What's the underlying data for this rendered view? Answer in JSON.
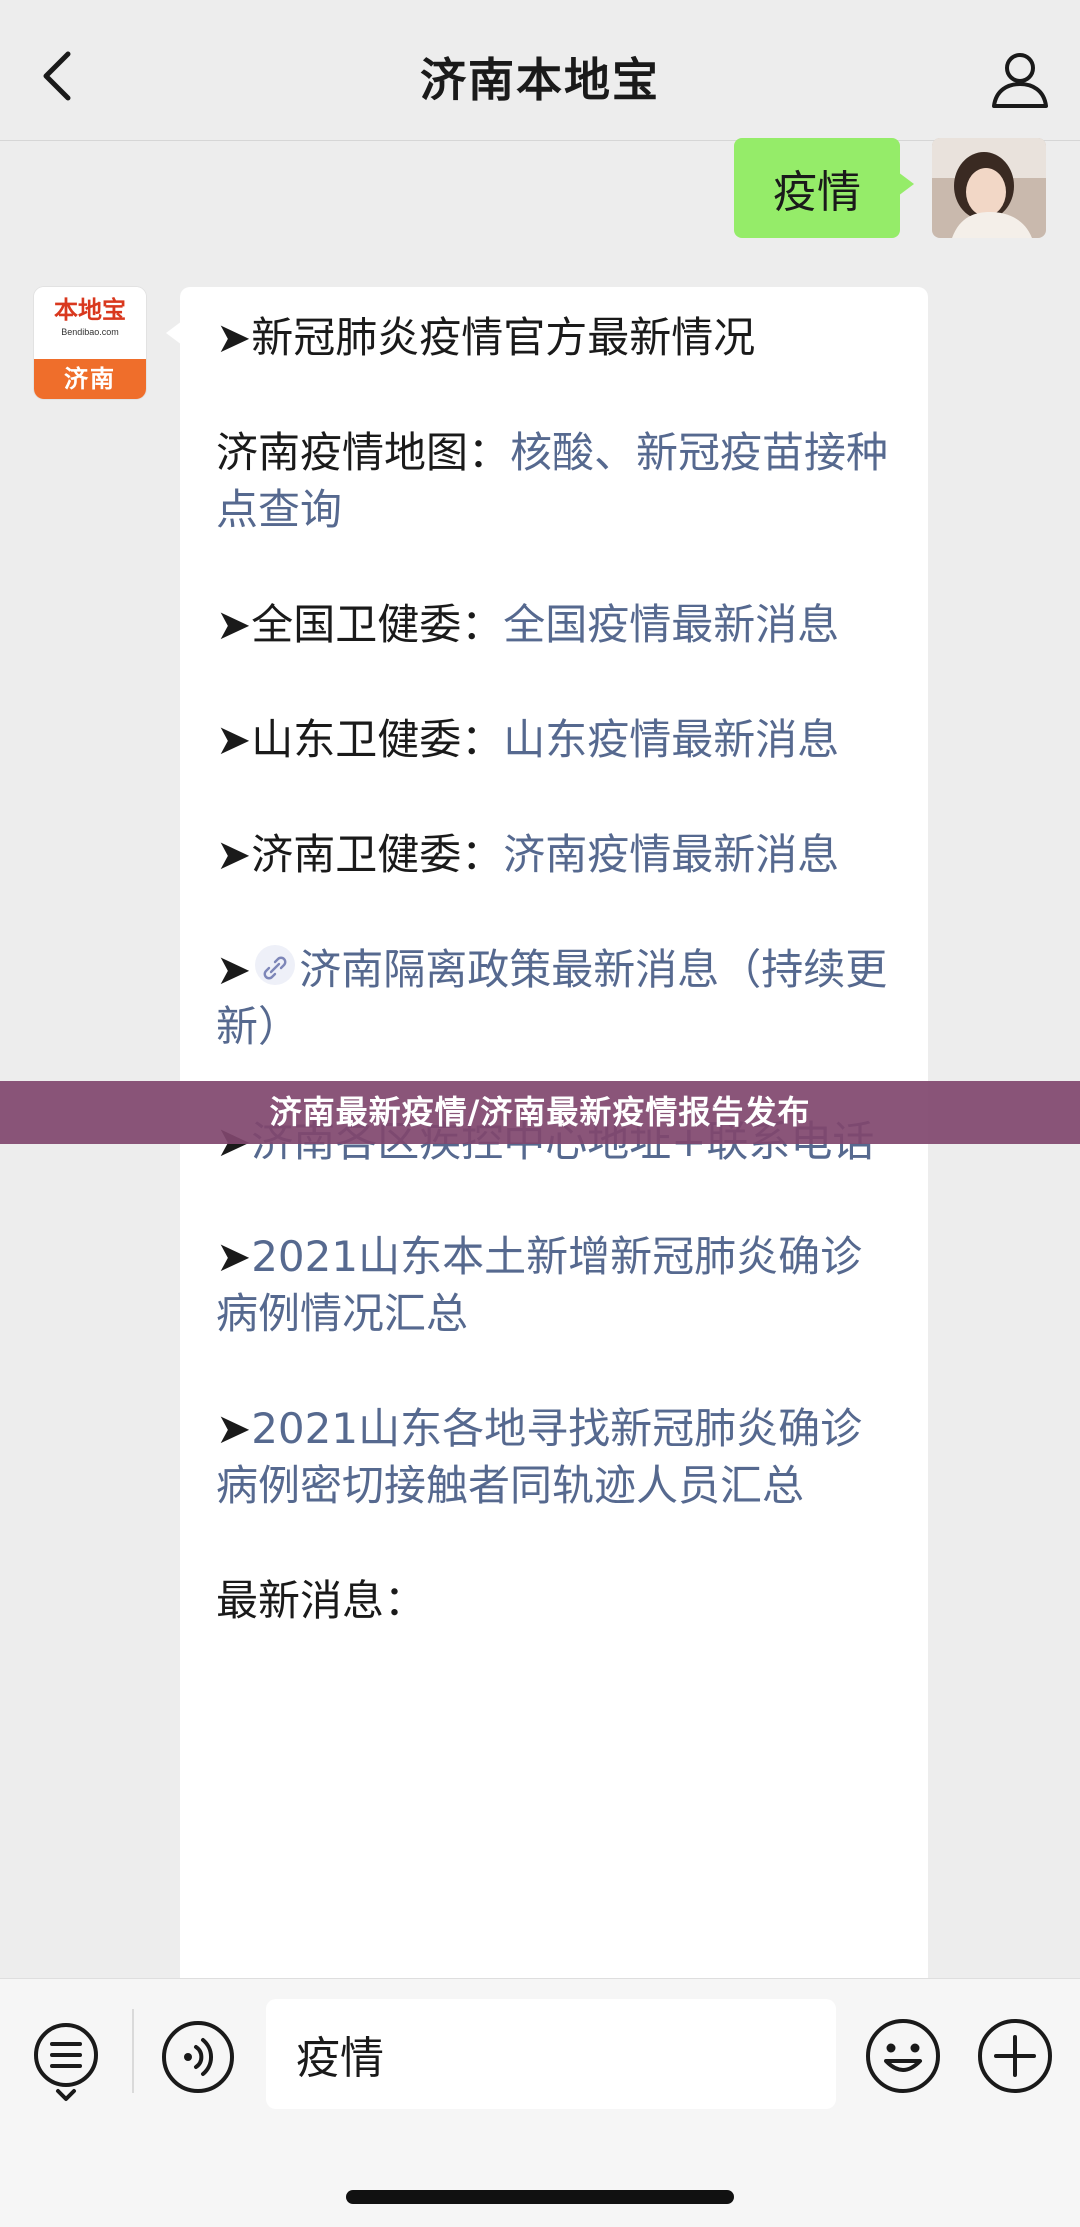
{
  "header": {
    "title": "济南本地宝",
    "back_icon": "chevron-left-icon",
    "profile_icon": "person-icon"
  },
  "user_message": {
    "text": "疫情"
  },
  "official_account": {
    "avatar_brand": "本地宝",
    "avatar_url": "Bendibao.com",
    "avatar_city": "济南"
  },
  "message": {
    "p1": "➤新冠肺炎疫情官方最新情况",
    "p2_label": "济南疫情地图：",
    "p2_link": "核酸、新冠疫苗接种点查询",
    "p3_label": "➤全国卫健委：",
    "p3_link": "全国疫情最新消息",
    "p4_label": "➤山东卫健委：",
    "p4_link": "山东疫情最新消息",
    "p5_label": "➤济南卫健委：",
    "p5_link": "济南疫情最新消息",
    "p6_prefix": "➤",
    "p6_link": "济南隔离政策最新消息（持续更新）",
    "p7_prefix": "➤",
    "p7_link": "济南各区疾控中心地址+联系电话",
    "p8_prefix": "➤",
    "p8_link": "2021山东本土新增新冠肺炎确诊病例情况汇总",
    "p9_prefix": "➤",
    "p9_link": "2021山东各地寻找新冠肺炎确诊病例密切接触者同轨迹人员汇总",
    "p10": "最新消息："
  },
  "banner": {
    "text": "济南最新疫情/济南最新疫情报告发布"
  },
  "input_bar": {
    "input_value": "疫情",
    "menu_icon": "menu-list-icon",
    "voice_icon": "voice-icon",
    "emoji_icon": "emoji-icon",
    "plus_icon": "plus-icon"
  },
  "colors": {
    "user_bubble": "#95ec69",
    "link": "#56698f",
    "banner": "#80466e",
    "avatar_orange": "#ef6e2b"
  }
}
